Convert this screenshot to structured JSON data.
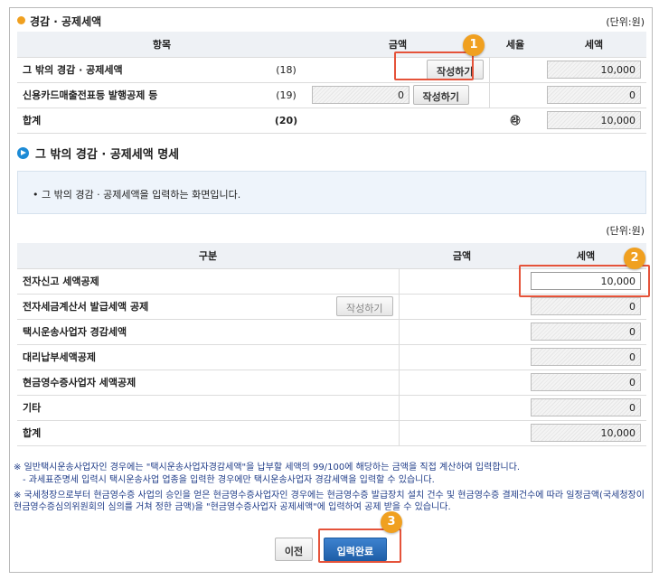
{
  "top_section": {
    "title": "경감 · 공제세액",
    "unit": "(단위:원)",
    "headers": {
      "item": "항목",
      "amount": "금액",
      "rate": "세율",
      "tax": "세액"
    },
    "rows": [
      {
        "label": "그 밖의 경감 · 공제세액",
        "code": "(18)",
        "amount": "",
        "button": "작성하기",
        "rate": "",
        "tax": "10,000"
      },
      {
        "label": "신용카드매출전표등 발행공제 등",
        "code": "(19)",
        "amount": "0",
        "button": "작성하기",
        "rate": "",
        "tax": "0"
      },
      {
        "label": "합계",
        "code": "(20)",
        "amount": "",
        "button": "",
        "rate": "㉱",
        "tax": "10,000"
      }
    ]
  },
  "detail_section": {
    "title": "그 밖의 경감 · 공제세액 명세",
    "info": "그 밖의 경감 · 공제세액을 입력하는 화면입니다.",
    "unit": "(단위:원)",
    "headers": {
      "category": "구분",
      "amount": "금액",
      "tax": "세액"
    },
    "rows": [
      {
        "label": "전자신고 세액공제",
        "tax": "10,000"
      },
      {
        "label": "전자세금계산서 발급세액 공제",
        "button": "작성하기",
        "tax": "0"
      },
      {
        "label": "택시운송사업자 경감세액",
        "tax": "0"
      },
      {
        "label": "대리납부세액공제",
        "tax": "0"
      },
      {
        "label": "현금영수증사업자 세액공제",
        "tax": "0"
      },
      {
        "label": "기타",
        "tax": "0"
      },
      {
        "label": "합계",
        "tax": "10,000"
      }
    ]
  },
  "notes": [
    "※ 일반택시운송사업자인 경우에는 \"택시운송사업자경감세액\"을 납부할 세액의 99/100에 해당하는 금액을 직접 계산하여 입력합니다.",
    "- 과세표준명세 입력시 택시운송사업 업종을 입력한 경우에만 택시운송사업자 경감세액을 입력할 수 있습니다.",
    "※ 국세청장으로부터 현금영수증 사업의 승인을 얻은 현금영수증사업자인 경우에는 현금영수증 발급장치 설치 건수 및 현금영수증 결제건수에 따라 일정금액(국세청장이 현금영수증심의위원회의 심의를 거쳐 정한 금액)을 \"현금영수증사업자 공제세액\"에 입력하여 공제 받을 수 있습니다."
  ],
  "buttons": {
    "prev": "이전",
    "done": "입력완료"
  },
  "badges": [
    "1",
    "2",
    "3"
  ],
  "colors": {
    "highlight": "#e5533a",
    "badge": "#f0a020",
    "primary_button": "#1f5fa8"
  }
}
